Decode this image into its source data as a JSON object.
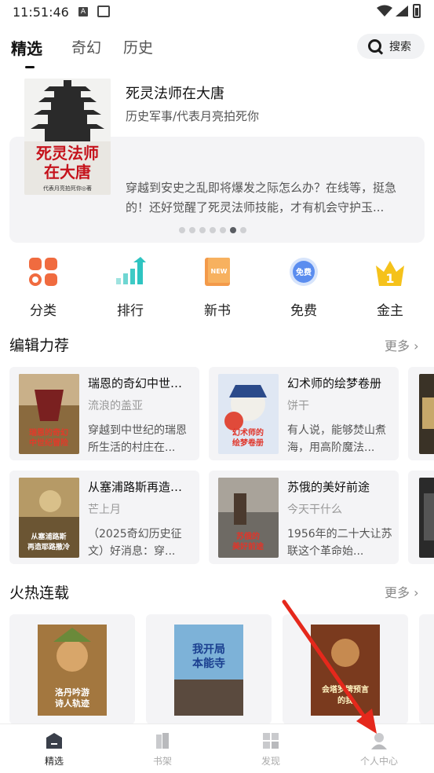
{
  "status_bar": {
    "time": "11:51:46",
    "notif_a": "A"
  },
  "tabs": [
    {
      "label": "精选",
      "active": true
    },
    {
      "label": "奇幻",
      "active": false
    },
    {
      "label": "历史",
      "active": false
    }
  ],
  "search": {
    "label": "搜索",
    "icon": "search-icon"
  },
  "banner": {
    "title": "死灵法师在大唐",
    "subtitle": "历史军事/代表月亮拍死你",
    "description": "穿越到安史之乱即将爆发之际怎么办？在线等，挺急的！还好觉醒了死灵法师技能，才有机会守护玉...",
    "cover_title": "死灵法师在大唐",
    "cover_author": "代表月亮拍死你◎著",
    "dots_total": 7,
    "dots_active": 5
  },
  "quick_nav": [
    {
      "label": "分类",
      "icon": "category-icon"
    },
    {
      "label": "排行",
      "icon": "ranking-icon"
    },
    {
      "label": "新书",
      "icon": "new-book-icon",
      "badge": "NEW"
    },
    {
      "label": "免费",
      "icon": "free-badge-icon",
      "badge": "免费"
    },
    {
      "label": "金主",
      "icon": "crown-icon",
      "badge": "1"
    }
  ],
  "editor_picks": {
    "title": "编辑力荐",
    "more": "更多",
    "books": [
      {
        "title": "瑞恩的奇幻中世纪...",
        "author": "流浪的盖亚",
        "desc": "穿越到中世纪的瑞恩所生活的村庄在...",
        "cover_text": "瑞恩的奇幻中世纪冒险"
      },
      {
        "title": "幻术师的绘梦卷册",
        "author": "饼干",
        "desc": "有人说，能够焚山煮海，用高阶魔法...",
        "cover_text": "幻术师的绘梦卷册"
      },
      {
        "title": "从塞浦路斯再造耶...",
        "author": "芒上月",
        "desc": "（2025奇幻历史征文）好消息：穿...",
        "cover_text": "从塞浦路斯再造耶路撒冷"
      },
      {
        "title": "苏俄的美好前途",
        "author": "今天干什么",
        "desc": "1956年的二十大让苏联这个革命始...",
        "cover_text": "苏俄的美好前途"
      }
    ]
  },
  "hot_serial": {
    "title": "火热连载",
    "more": "更多",
    "books": [
      {
        "cover_text": "洛丹吟游诗人轨迹"
      },
      {
        "cover_text": "我开局本能寺"
      },
      {
        "cover_text": "会塔罗牌预言的我"
      }
    ]
  },
  "bottom_nav": [
    {
      "label": "精选",
      "icon": "home-book-icon",
      "active": true
    },
    {
      "label": "书架",
      "icon": "bookshelf-icon",
      "active": false
    },
    {
      "label": "发现",
      "icon": "discover-icon",
      "active": false
    },
    {
      "label": "个人中心",
      "icon": "profile-icon",
      "active": false
    }
  ],
  "colors": {
    "accent_orange": "#f06b3f",
    "accent_teal": "#2ec4c1",
    "accent_blue": "#5b8def",
    "accent_gold": "#f5c21b",
    "annotation_red": "#e5281c"
  }
}
